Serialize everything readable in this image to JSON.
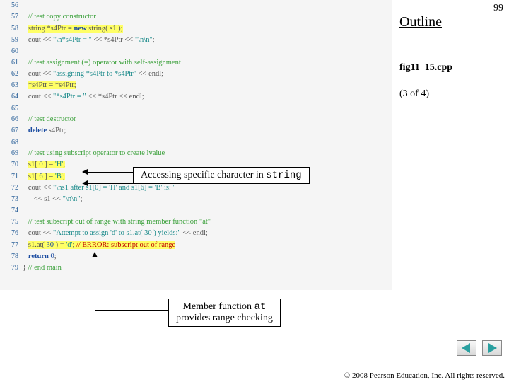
{
  "page_number": "99",
  "outline": "Outline",
  "fig_label": "fig11_15.cpp",
  "page_part": "(3 of 4)",
  "callout1": {
    "prefix": "Accessing specific character in ",
    "mono": "string"
  },
  "callout2": {
    "line1_prefix": "Member function ",
    "line1_mono": "at",
    "line2": "provides range checking"
  },
  "copyright": "© 2008 Pearson Education, Inc.  All rights reserved.",
  "code": {
    "56": {
      "indent": "   ",
      "segs": []
    },
    "57": {
      "indent": "   ",
      "segs": [
        {
          "t": "// test copy constructor",
          "c": "comment"
        }
      ]
    },
    "58": {
      "indent": "   ",
      "segs": [
        {
          "t": "string *s4Ptr = ",
          "c": "hl"
        },
        {
          "t": "new",
          "c": "kw hl"
        },
        {
          "t": " string( s1 );",
          "c": "hl"
        }
      ]
    },
    "59": {
      "indent": "   ",
      "segs": [
        {
          "t": "cout << "
        },
        {
          "t": "\"\\n*s4Ptr = \"",
          "c": "str"
        },
        {
          "t": " << *s4Ptr << "
        },
        {
          "t": "\"\\n\\n\"",
          "c": "str"
        },
        {
          "t": ";"
        }
      ]
    },
    "60": {
      "indent": "",
      "segs": []
    },
    "61": {
      "indent": "   ",
      "segs": [
        {
          "t": "// test assignment (=) operator with self-assignment",
          "c": "comment"
        }
      ]
    },
    "62": {
      "indent": "   ",
      "segs": [
        {
          "t": "cout << "
        },
        {
          "t": "\"assigning *s4Ptr to *s4Ptr\"",
          "c": "str"
        },
        {
          "t": " << endl;"
        }
      ]
    },
    "63": {
      "indent": "   ",
      "segs": [
        {
          "t": "*s4Ptr = *s4Ptr;",
          "c": "hl"
        }
      ]
    },
    "64": {
      "indent": "   ",
      "segs": [
        {
          "t": "cout << "
        },
        {
          "t": "\"*s4Ptr = \"",
          "c": "str"
        },
        {
          "t": " << *s4Ptr << endl;"
        }
      ]
    },
    "65": {
      "indent": "",
      "segs": []
    },
    "66": {
      "indent": "   ",
      "segs": [
        {
          "t": "// test destructor",
          "c": "comment"
        }
      ]
    },
    "67": {
      "indent": "   ",
      "segs": [
        {
          "t": "delete",
          "c": "kw"
        },
        {
          "t": " s4Ptr;"
        }
      ]
    },
    "68": {
      "indent": "",
      "segs": []
    },
    "69": {
      "indent": "   ",
      "segs": [
        {
          "t": "// test using subscript operator to create lvalue",
          "c": "comment"
        }
      ]
    },
    "70": {
      "indent": "   ",
      "segs": [
        {
          "t": "s1[ ",
          "c": "hl"
        },
        {
          "t": "0",
          "c": "ch hl"
        },
        {
          "t": " ] = ",
          "c": "hl"
        },
        {
          "t": "'H'",
          "c": "str hl"
        },
        {
          "t": ";",
          "c": "hl"
        }
      ]
    },
    "71": {
      "indent": "   ",
      "segs": [
        {
          "t": "s1[ ",
          "c": "hl"
        },
        {
          "t": "6",
          "c": "ch hl"
        },
        {
          "t": " ] = ",
          "c": "hl"
        },
        {
          "t": "'B'",
          "c": "str hl"
        },
        {
          "t": ";",
          "c": "hl"
        }
      ]
    },
    "72": {
      "indent": "   ",
      "segs": [
        {
          "t": "cout << "
        },
        {
          "t": "\"\\ns1 after s1[0] = 'H' and s1[6] = 'B' is: \"",
          "c": "str"
        }
      ]
    },
    "73": {
      "indent": "      ",
      "segs": [
        {
          "t": "<< s1 << "
        },
        {
          "t": "\"\\n\\n\"",
          "c": "str"
        },
        {
          "t": ";"
        }
      ]
    },
    "74": {
      "indent": "",
      "segs": []
    },
    "75": {
      "indent": "   ",
      "segs": [
        {
          "t": "// test subscript out of range with string member function \"at\"",
          "c": "comment"
        }
      ]
    },
    "76": {
      "indent": "   ",
      "segs": [
        {
          "t": "cout << "
        },
        {
          "t": "\"Attempt to assign 'd' to s1.at( 30 ) yields:\"",
          "c": "str"
        },
        {
          "t": " << endl;"
        }
      ]
    },
    "77": {
      "indent": "   ",
      "segs": [
        {
          "t": "s1.at( ",
          "c": "hl"
        },
        {
          "t": "30",
          "c": "ch hl"
        },
        {
          "t": " ) = ",
          "c": "hl"
        },
        {
          "t": "'d'",
          "c": "str hl"
        },
        {
          "t": "; ",
          "c": "hl"
        },
        {
          "t": "// ERROR: subscript out of range",
          "c": "err hl"
        }
      ]
    },
    "78": {
      "indent": "   ",
      "segs": [
        {
          "t": "return",
          "c": "kw"
        },
        {
          "t": " "
        },
        {
          "t": "0",
          "c": "ch"
        },
        {
          "t": ";"
        }
      ]
    },
    "79": {
      "indent": "",
      "segs": [
        {
          "t": "} "
        },
        {
          "t": "// end main",
          "c": "comment"
        }
      ]
    }
  }
}
